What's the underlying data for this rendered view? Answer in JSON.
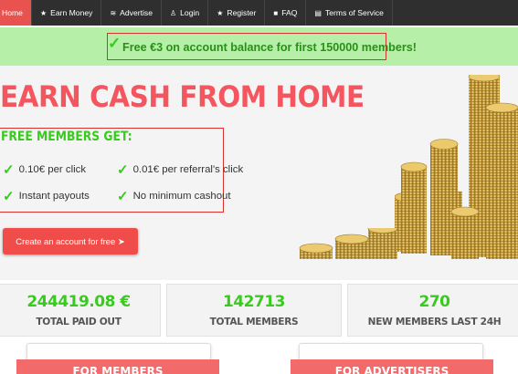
{
  "nav": {
    "items": [
      {
        "label": "Home",
        "icon": ""
      },
      {
        "label": "Earn Money",
        "icon": "star-icon"
      },
      {
        "label": "Advertise",
        "icon": "broadcast-icon"
      },
      {
        "label": "Login",
        "icon": "user-icon"
      },
      {
        "label": "Register",
        "icon": "star-icon"
      },
      {
        "label": "FAQ",
        "icon": "book-icon"
      },
      {
        "label": "Terms of Service",
        "icon": "document-icon"
      }
    ],
    "active_color": "#e8534f"
  },
  "promo": {
    "text": "Free €3 on account balance for first 150000 members!"
  },
  "hero": {
    "title": "EARN CASH FROM HOME",
    "features_heading": "FREE MEMBERS GET:",
    "features": [
      "0.10€ per click",
      "0.01€ per referral's click",
      "Instant payouts",
      "No minimum cashout"
    ],
    "cta_label": "Create an account for free ➤"
  },
  "stats": [
    {
      "value": "244419.08 €",
      "label": "TOTAL PAID OUT"
    },
    {
      "value": "142713",
      "label": "TOTAL MEMBERS"
    },
    {
      "value": "270",
      "label": "NEW MEMBERS LAST 24H"
    }
  ],
  "cards": {
    "members_title": "FOR MEMBERS",
    "advertisers_title": "FOR ADVERTISERS"
  },
  "colors": {
    "accent": "#f4565f",
    "green": "#39c91f",
    "nav_bg": "#2f2f2f",
    "promo_bg": "#b6f0a8"
  }
}
